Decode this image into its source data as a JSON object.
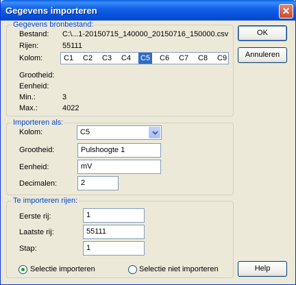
{
  "window": {
    "title": "Gegevens importeren",
    "close_icon": "close-icon"
  },
  "source": {
    "legend": "Gegevens bronbestand:",
    "bestand_label": "Bestand:",
    "bestand_value": "C:\\...1-20150715_140000_20150716_150000.csv",
    "rijen_label": "Rijen:",
    "rijen_value": "55111",
    "kolom_label": "Kolom:",
    "columns": [
      "C1",
      "C2",
      "C3",
      "C4",
      "C5",
      "C6",
      "C7",
      "C8",
      "C9"
    ],
    "selected_column": "C5",
    "grootheid_label": "Grootheid:",
    "eenheid_label": "Eenheid:",
    "min_label": "Min.:",
    "min_value": "3",
    "max_label": "Max.:",
    "max_value": "4022"
  },
  "import_as": {
    "legend": "Importeren als:",
    "kolom_label": "Kolom:",
    "kolom_value": "C5",
    "grootheid_label": "Grootheid:",
    "grootheid_value": "Pulshoogte 1",
    "eenheid_label": "Eenheid:",
    "eenheid_value": "mV",
    "decimalen_label": "Decimalen:",
    "decimalen_value": "2"
  },
  "rows": {
    "legend": "Te importeren rijen:",
    "eerste_label": "Eerste rij:",
    "eerste_value": "1",
    "laatste_label": "Laatste rij:",
    "laatste_value": "55111",
    "stap_label": "Stap:",
    "stap_value": "1",
    "radio_selectie": "Selectie importeren",
    "radio_niet": "Selectie niet importeren",
    "selected_radio": "Selectie importeren"
  },
  "buttons": {
    "ok": "OK",
    "annuleren": "Annuleren",
    "help": "Help"
  },
  "colors": {
    "accent": "#0046d5",
    "selection": "#316ac5",
    "titlebar": "#0551dc"
  }
}
